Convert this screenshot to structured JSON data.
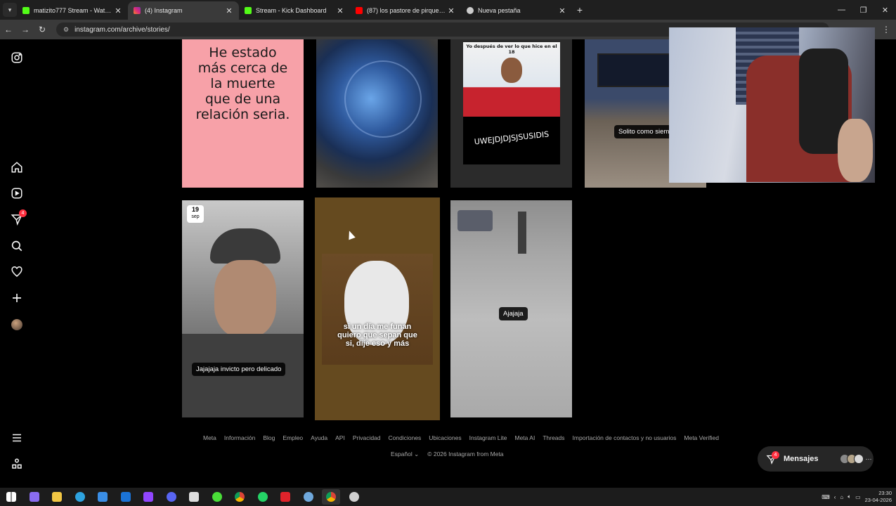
{
  "browser": {
    "tabs": [
      {
        "title": "matizito777 Stream - Watch Live",
        "icon": "kick-icon",
        "color": "#53fc18",
        "active": false
      },
      {
        "title": "(4) Instagram",
        "icon": "instagram-icon",
        "color": "#e1306c",
        "active": true
      },
      {
        "title": "Stream - Kick Dashboard",
        "icon": "kick-icon",
        "color": "#53fc18",
        "active": false
      },
      {
        "title": "(87) los pastore de pirque - YouTube",
        "icon": "youtube-icon",
        "color": "#ff0000",
        "active": false
      },
      {
        "title": "Nueva pestaña",
        "icon": "chrome-icon",
        "color": "#cccccc",
        "active": false
      }
    ],
    "url": "instagram.com/archive/stories/"
  },
  "sidebar": {
    "notification_count": "4"
  },
  "stories": [
    {
      "lines": [
        "He estado",
        "más cerca de",
        "la muerte",
        "que de una",
        "relación seria."
      ]
    },
    {
      "caption": ""
    },
    {
      "header": "Yo después de ver lo que hice en el 18",
      "caption": "UWEJDJDJSJSUSIDIS"
    },
    {
      "caption": "Solito como siempre"
    },
    {
      "date_day": "19",
      "date_month": "sep",
      "caption": "Jajajaja invicto pero delicado"
    },
    {
      "caption_lines": [
        "si un día me funan",
        "quiero que sepan que",
        "si, dije eso y más"
      ]
    },
    {
      "caption": "Ajajaja"
    }
  ],
  "footer": {
    "links": [
      "Meta",
      "Información",
      "Blog",
      "Empleo",
      "Ayuda",
      "API",
      "Privacidad",
      "Condiciones",
      "Ubicaciones",
      "Instagram Lite",
      "Meta AI",
      "Threads",
      "Importación de contactos y no usuarios",
      "Meta Verified"
    ],
    "language": "Español",
    "copyright": "© 2026 Instagram from Meta"
  },
  "messages": {
    "label": "Mensajes",
    "badge": "4"
  },
  "taskbar": {
    "apps": [
      {
        "name": "windows-start-icon",
        "color": "#ffffff"
      },
      {
        "name": "copilot-icon",
        "color": "#8a6cf0"
      },
      {
        "name": "file-explorer-icon",
        "color": "#f2c744"
      },
      {
        "name": "edge-icon",
        "color": "#2ea3e0"
      },
      {
        "name": "store-icon",
        "color": "#3a8ee6"
      },
      {
        "name": "outlook-icon",
        "color": "#1b73d6"
      },
      {
        "name": "twitch-icon",
        "color": "#9146ff"
      },
      {
        "name": "discord-icon",
        "color": "#5865f2"
      },
      {
        "name": "epic-games-icon",
        "color": "#dddddd"
      },
      {
        "name": "xbox-icon",
        "color": "#4ade38"
      },
      {
        "name": "chrome-icon",
        "color": "#f2b705"
      },
      {
        "name": "whatsapp-icon",
        "color": "#25d366"
      },
      {
        "name": "acrobat-icon",
        "color": "#e0232b"
      },
      {
        "name": "steam-icon",
        "color": "#6fa8dc"
      },
      {
        "name": "chrome-active-icon",
        "color": "#f2b705"
      },
      {
        "name": "obs-icon",
        "color": "#cfcfcf"
      }
    ],
    "time": "23:30",
    "date": "23-04-2026"
  }
}
